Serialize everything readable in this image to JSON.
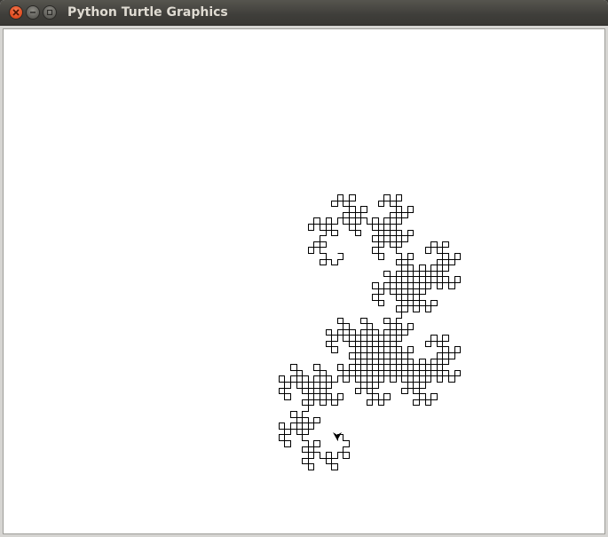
{
  "window": {
    "title": "Python Turtle Graphics",
    "buttons": {
      "close": "close-icon",
      "minimize": "minimize-icon",
      "maximize": "maximize-icon"
    }
  },
  "canvas": {
    "background": "#ffffff",
    "line_color": "#000000",
    "turtle_shape": "arrow",
    "turtle_heading": "down",
    "drawing": "dragon-curve"
  }
}
